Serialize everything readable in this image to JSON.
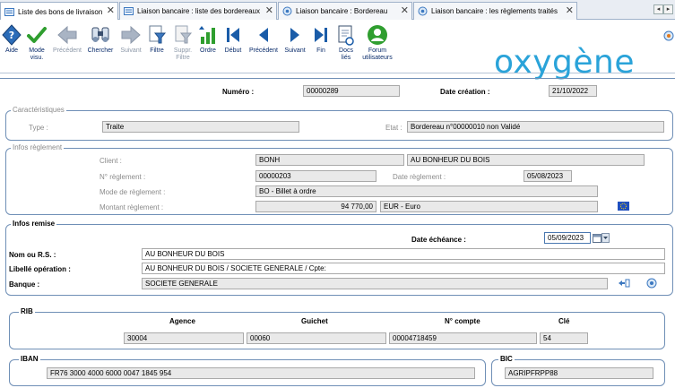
{
  "tabs": [
    {
      "label": "Liste des bons de livraison",
      "active": true
    },
    {
      "label": "Liaison bancaire : liste des bordereaux",
      "active": false
    },
    {
      "label": "Liaison bancaire : Bordereau",
      "active": false
    },
    {
      "label": "Liaison bancaire : les règlements traités",
      "active": false
    }
  ],
  "toolbar": {
    "aide": "Aide",
    "mode_visu_1": "Mode",
    "mode_visu_2": "visu.",
    "precedent": "Précédent",
    "chercher": "Chercher",
    "suivant": "Suivant",
    "filtre": "Filtre",
    "suppr_filtre_1": "Suppr.",
    "suppr_filtre_2": "Filtre",
    "ordre": "Ordre",
    "debut": "Début",
    "precedent2": "Précédent",
    "suivant2": "Suivant",
    "fin": "Fin",
    "docs_1": "Docs",
    "docs_2": "liés",
    "forum_1": "Forum",
    "forum_2": "utilisateurs"
  },
  "logo": "oxygène",
  "header": {
    "numero_label": "Numéro :",
    "numero_value": "00000289",
    "date_creation_label": "Date création :",
    "date_creation_value": "21/10/2022"
  },
  "caracteristiques": {
    "legend": "Caractéristiques",
    "type_label": "Type :",
    "type_value": "Traite",
    "etat_label": "Etat :",
    "etat_value": "Bordereau n°00000010 non Validé"
  },
  "infos_reglement": {
    "legend": "Infos règlement",
    "client_label": "Client :",
    "client_code": "BONH",
    "client_name": "AU BONHEUR DU BOIS",
    "num_reglement_label": "N° règlement :",
    "num_reglement_value": "00000203",
    "date_reglement_label": "Date règlement :",
    "date_reglement_value": "05/08/2023",
    "mode_label": "Mode de règlement :",
    "mode_value": "BO - Billet à ordre",
    "montant_label": "Montant règlement :",
    "montant_value": "94 770,00",
    "devise_value": "EUR - Euro"
  },
  "infos_remise": {
    "legend": "Infos remise",
    "date_echeance_label": "Date échéance :",
    "date_echeance_value": "05/09/2023",
    "nom_label": "Nom ou R.S. :",
    "nom_value": "AU BONHEUR DU BOIS",
    "libelle_label": "Libellé opération :",
    "libelle_value": "AU BONHEUR DU BOIS / SOCIETE GENERALE / Cpte:",
    "banque_label": "Banque :",
    "banque_value": "SOCIETE GENERALE"
  },
  "rib": {
    "legend": "RIB",
    "agence_label": "Agence",
    "guichet_label": "Guichet",
    "compte_label": "N° compte",
    "cle_label": "Clé",
    "agence_value": "30004",
    "guichet_value": "00060",
    "compte_value": "00004718459",
    "cle_value": "54"
  },
  "iban": {
    "legend": "IBAN",
    "value": "FR76  3000  4000  6000  0047  1845  954"
  },
  "bic": {
    "legend": "BIC",
    "value": "AGRIPFRPP88"
  },
  "colors": {
    "accent": "#2aa3d9",
    "toolbar_blue": "#1a5ca8",
    "green": "#2f9e2f",
    "frame": "#6f8fb6"
  }
}
